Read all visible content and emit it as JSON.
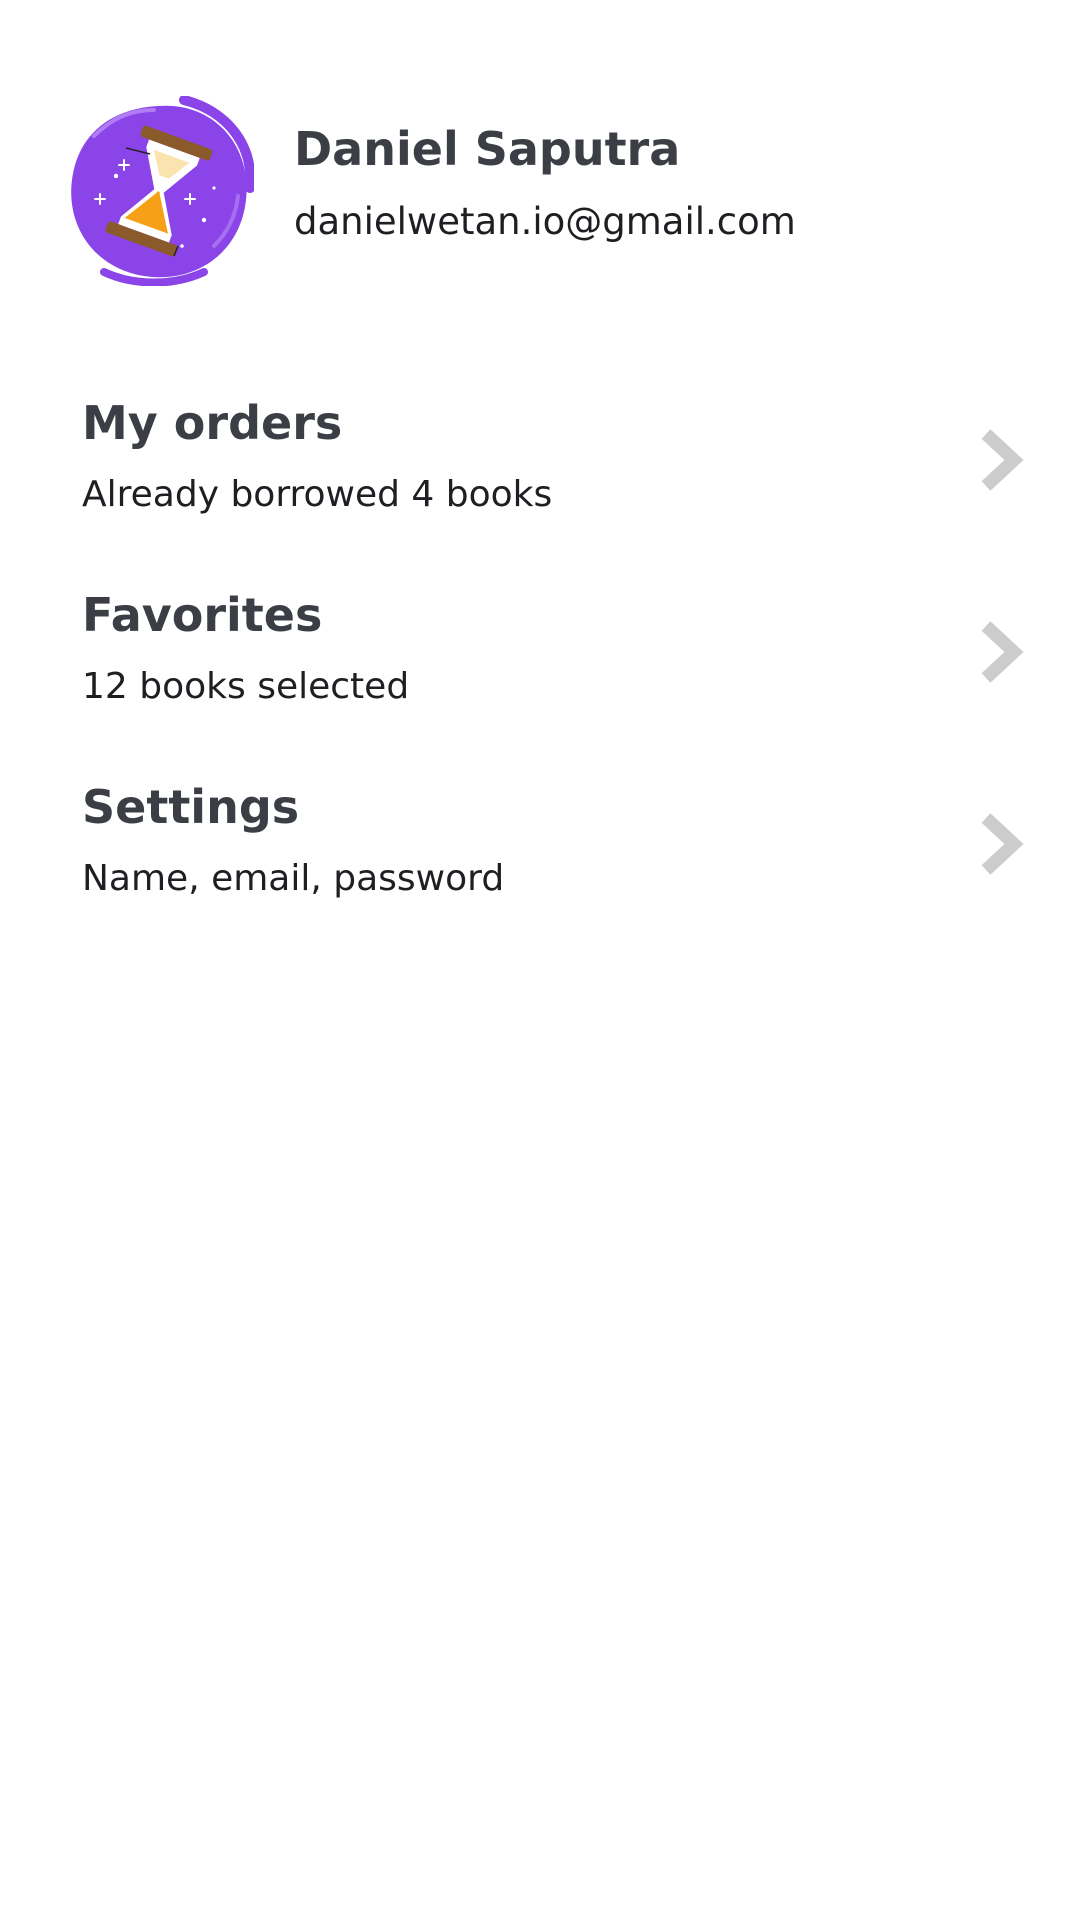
{
  "profile": {
    "name": "Daniel Saputra",
    "email": "danielwetan.io@gmail.com",
    "avatar_icon": "hourglass-icon",
    "avatar_colors": {
      "background": "#8a44e8",
      "sand": "#f5a016",
      "frame": "#8b5a2b"
    }
  },
  "menu": {
    "items": [
      {
        "title": "My orders",
        "subtitle": "Already borrowed 4 books",
        "icon": "chevron-right-icon"
      },
      {
        "title": "Favorites",
        "subtitle": "12 books selected",
        "icon": "chevron-right-icon"
      },
      {
        "title": "Settings",
        "subtitle": "Name, email, password",
        "icon": "chevron-right-icon"
      }
    ]
  },
  "colors": {
    "title_text": "#3b3f45",
    "body_text": "#1d1f22",
    "chevron": "#cccccc",
    "background": "#ffffff"
  }
}
